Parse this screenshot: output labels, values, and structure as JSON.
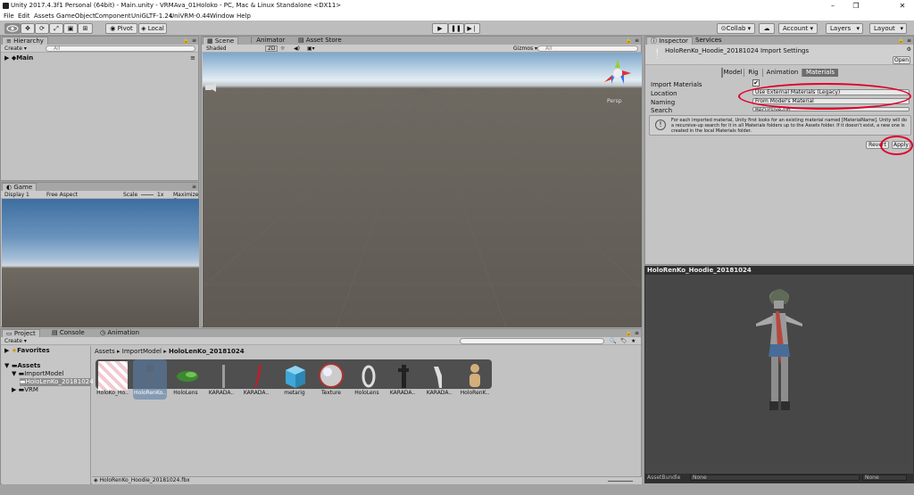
{
  "window": {
    "title": "Unity 2017.4.3f1 Personal (64bit) - Main.unity - VRMAva_01Holoko - PC, Mac & Linux Standalone <DX11>",
    "minimize": "–",
    "maximize": "❐",
    "close": "✕"
  },
  "menu": [
    "File",
    "Edit",
    "Assets",
    "GameObject",
    "Component",
    "UniGLTF-1.24",
    "UniVRM-0.44",
    "Window",
    "Help"
  ],
  "toolbar": {
    "pivot": "Pivot",
    "local": "Local",
    "collab": "Collab ▾",
    "account": "Account ▾",
    "layers": "Layers",
    "layout": "Layout"
  },
  "hierarchy": {
    "tab": "Hierarchy",
    "create": "Create ▾",
    "search": "All",
    "scene_item": "Main"
  },
  "scene": {
    "tabs": [
      "Scene",
      "Animator",
      "Asset Store"
    ],
    "shading": "Shaded",
    "mode2d": "2D",
    "gizmos": "Gizmos ▾",
    "search": "All",
    "persp": "Persp"
  },
  "game": {
    "tab": "Game",
    "display": "Display 1",
    "aspect": "Free Aspect",
    "scale_label": "Scale",
    "scale_value": "1x",
    "maximize": "Maximize C"
  },
  "inspector": {
    "tabs": [
      "Inspector",
      "Services"
    ],
    "header": "HoloRenKo_Hoodie_20181024 Import Settings",
    "open": "Open",
    "subtabs": [
      "Model",
      "Rig",
      "Animation",
      "Materials"
    ],
    "import_materials_label": "Import Materials",
    "location_label": "Location",
    "location_value": "Use External Materials (Legacy)",
    "naming_label": "Naming",
    "naming_value": "From Model's Material",
    "search_label": "Search",
    "search_value": "Recursive-Up",
    "help_text": "For each imported material, Unity first looks for an existing material named [MaterialName]. Unity will do a recursive-up search for it in all Materials folders up to the Assets folder. If it doesn't exist, a new one is created in the local Materials folder.",
    "revert": "Revert",
    "apply": "Apply"
  },
  "preview": {
    "title": "HoloRenKo_Hoodie_20181024",
    "assetbundle": "AssetBundle",
    "none1": "None",
    "none2": "None"
  },
  "project": {
    "tabs": [
      "Project",
      "Console",
      "Animation"
    ],
    "create": "Create ▾",
    "tree": {
      "favorites": "Favorites",
      "assets": "Assets",
      "import_model": "ImportModel",
      "selected_file": "HoloLenKo_20181024",
      "vrm": "VRM"
    },
    "breadcrumb": [
      "Assets",
      "ImportModel",
      "HoloLenKo_20181024"
    ],
    "items": [
      "HoloKo_Ho..",
      "HoloRenKo..",
      "HoloLens",
      "KARADA..",
      "KARADA..",
      "metarig",
      "Texture",
      "HoloLens",
      "KARADA..",
      "KARADA..",
      "HoloRenK.."
    ],
    "status_file": "HoloRenKo_Hoodie_20181024.fbx"
  }
}
